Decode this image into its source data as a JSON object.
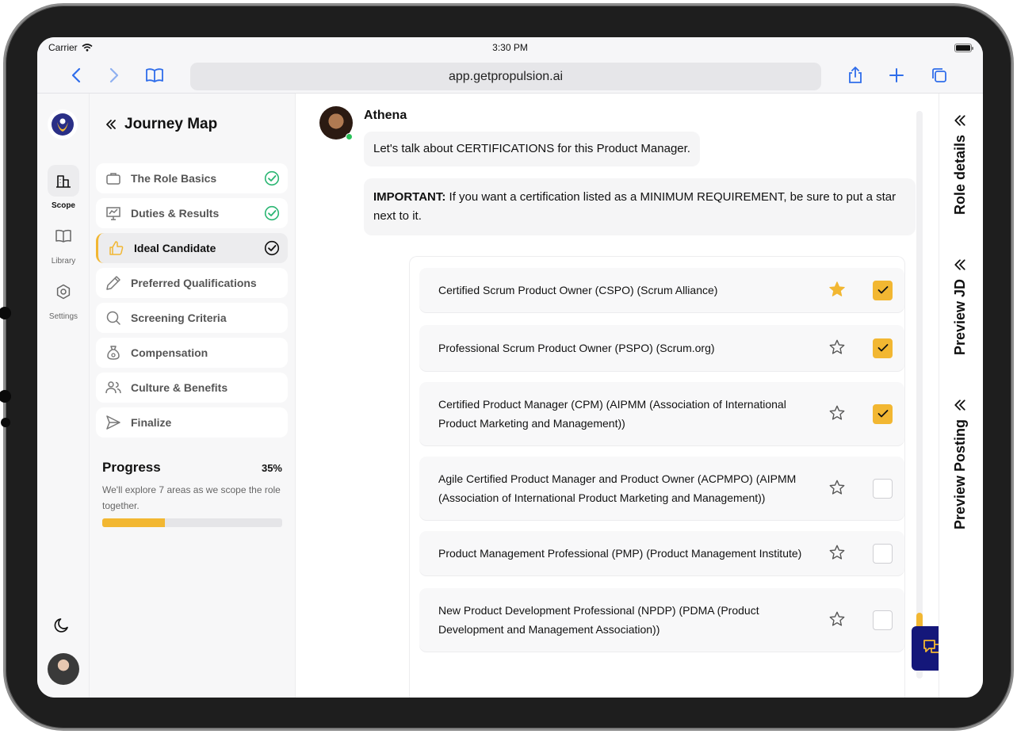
{
  "status_bar": {
    "carrier": "Carrier",
    "time": "3:30 PM"
  },
  "browser": {
    "url": "app.getpropulsion.ai"
  },
  "rail": {
    "items": [
      {
        "label": "Scope",
        "icon": "building-icon",
        "active": true
      },
      {
        "label": "Library",
        "icon": "book-icon",
        "active": false
      },
      {
        "label": "Settings",
        "icon": "gear-icon",
        "active": false
      }
    ]
  },
  "journey": {
    "title": "Journey Map",
    "steps": [
      {
        "label": "The Role Basics",
        "icon": "briefcase-icon",
        "status": "complete"
      },
      {
        "label": "Duties & Results",
        "icon": "presentation-icon",
        "status": "complete"
      },
      {
        "label": "Ideal Candidate",
        "icon": "thumbs-up-icon",
        "status": "active"
      },
      {
        "label": "Preferred Qualifications",
        "icon": "pen-icon",
        "status": "pending"
      },
      {
        "label": "Screening Criteria",
        "icon": "search-icon",
        "status": "pending"
      },
      {
        "label": "Compensation",
        "icon": "money-bag-icon",
        "status": "pending"
      },
      {
        "label": "Culture & Benefits",
        "icon": "people-icon",
        "status": "pending"
      },
      {
        "label": "Finalize",
        "icon": "send-icon",
        "status": "pending"
      }
    ],
    "progress": {
      "title": "Progress",
      "percent_label": "35%",
      "value": 0.35,
      "description": "We'll explore 7 areas as we scope the role together."
    }
  },
  "chat": {
    "sender": "Athena",
    "message_1": "Let's talk about CERTIFICATIONS for this Product Manager.",
    "message_2_bold": "IMPORTANT:",
    "message_2_rest": " If you want a certification listed as a MINIMUM REQUIREMENT, be sure to put a star next to it.",
    "certifications": [
      {
        "text": "Certified Scrum Product Owner (CSPO) (Scrum Alliance)",
        "starred": true,
        "checked": true
      },
      {
        "text": "Professional Scrum Product Owner (PSPO) (Scrum.org)",
        "starred": false,
        "checked": true
      },
      {
        "text": "Certified Product Manager (CPM) (AIPMM (Association of International Product Marketing and Management))",
        "starred": false,
        "checked": true
      },
      {
        "text": "Agile Certified Product Manager and Product Owner (ACPMPO) (AIPMM (Association of International Product Marketing and Management))",
        "starred": false,
        "checked": false
      },
      {
        "text": "Product Management Professional (PMP) (Product Management Institute)",
        "starred": false,
        "checked": false
      },
      {
        "text": "New Product Development Professional (NPDP) (PDMA (Product Development and Management Association))",
        "starred": false,
        "checked": false
      }
    ]
  },
  "right_panel": {
    "tabs": [
      "Role details",
      "Preview JD",
      "Preview Posting"
    ]
  },
  "colors": {
    "accent": "#f2b732",
    "check_green": "#2bb673",
    "fab": "#14177a",
    "link_blue": "#2f6dea"
  }
}
